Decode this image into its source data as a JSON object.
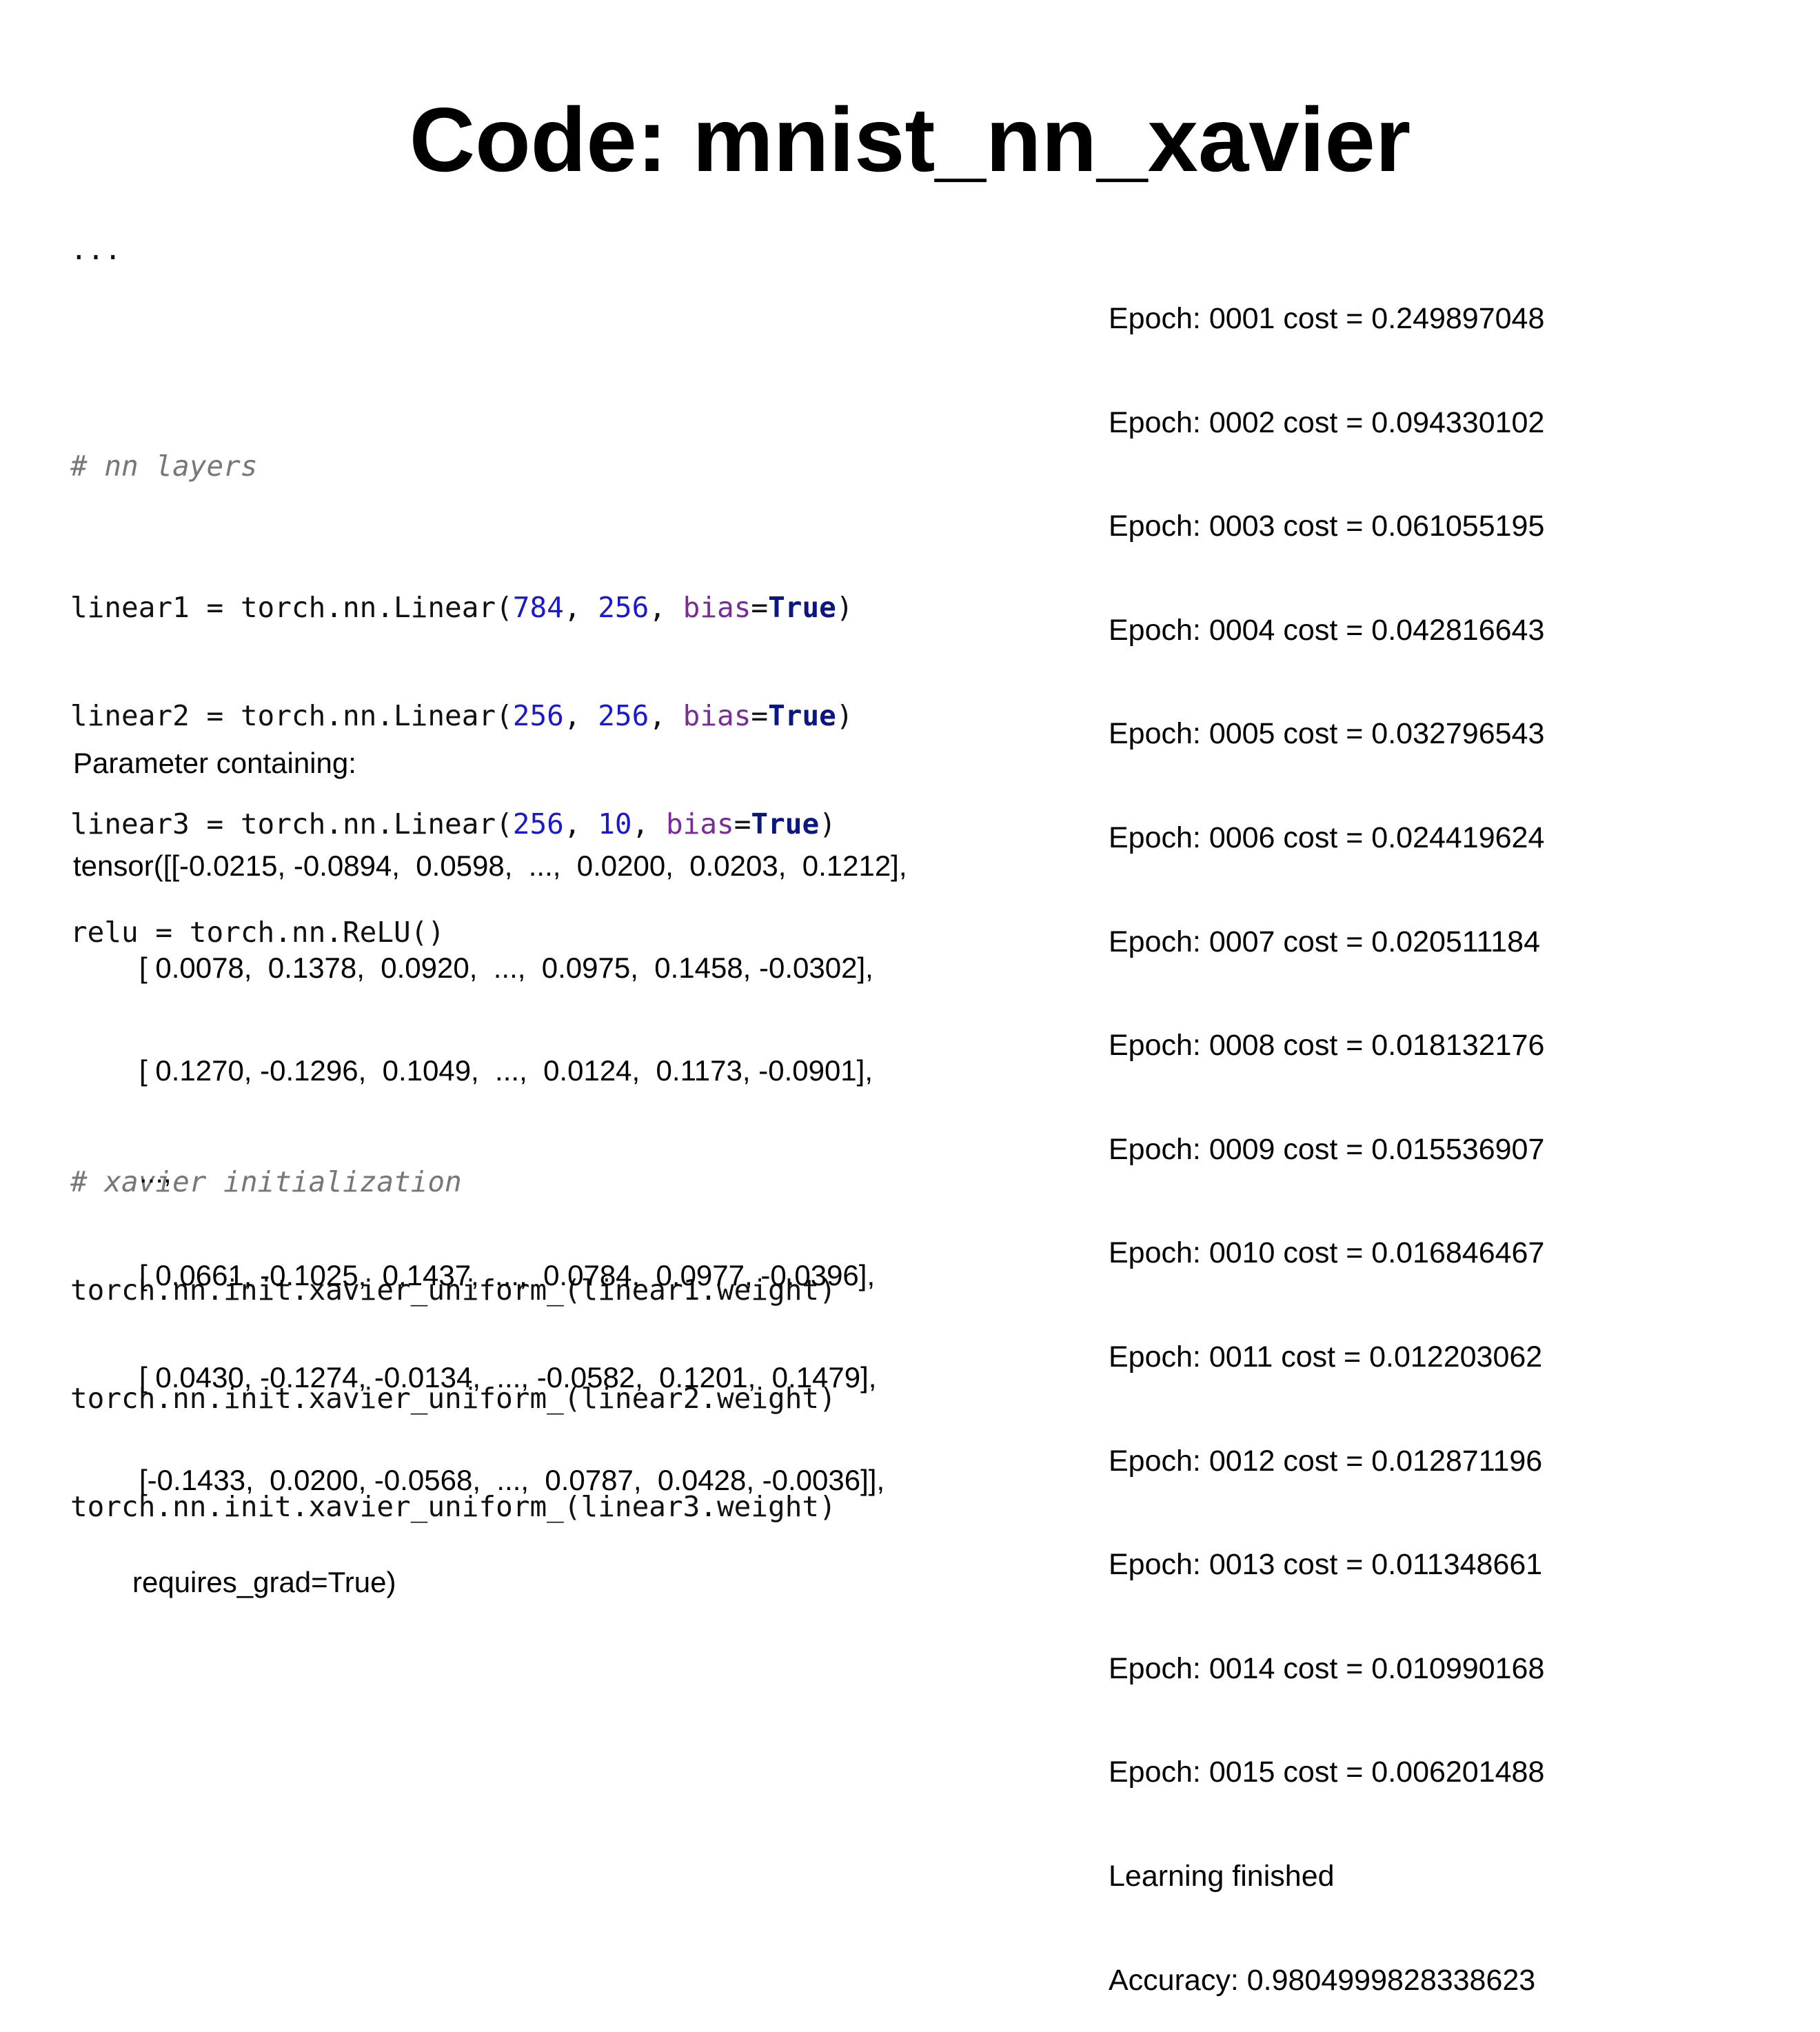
{
  "title": "Code: mnist_nn_xavier",
  "code": {
    "ellipsis": "...",
    "comment_layers": "# nn layers",
    "lines": [
      {
        "prefix": "linear1 = torch.nn.Linear(",
        "a": "784",
        "b": "256",
        "kw": "bias",
        "val": "True"
      },
      {
        "prefix": "linear2 = torch.nn.Linear(",
        "a": "256",
        "b": "256",
        "kw": "bias",
        "val": "True"
      },
      {
        "prefix": "linear3 = torch.nn.Linear(",
        "a": "256",
        "b": "10",
        "kw": "bias",
        "val": "True"
      }
    ],
    "relu_line": "relu = torch.nn.ReLU()",
    "comment_xavier": "# xavier initialization",
    "init_lines": [
      "torch.nn.init.xavier_uniform_(linear1.weight)",
      "torch.nn.init.xavier_uniform_(linear2.weight)",
      "torch.nn.init.xavier_uniform_(linear3.weight)"
    ]
  },
  "parameter_output": {
    "header": "Parameter containing:",
    "first_row": "tensor([[-0.0215, -0.0894,  0.0598,  ...,  0.0200,  0.0203,  0.1212],",
    "rows": [
      "[ 0.0078,  0.1378,  0.0920,  ...,  0.0975,  0.1458, -0.0302],",
      "[ 0.1270, -0.1296,  0.1049,  ...,  0.0124,  0.1173, -0.0901],",
      "...,",
      "[ 0.0661, -0.1025,  0.1437,  ...,  0.0784,  0.0977, -0.0396],",
      "[ 0.0430, -0.1274, -0.0134,  ..., -0.0582,  0.1201,  0.1479],",
      "[-0.1433,  0.0200, -0.0568,  ...,  0.0787,  0.0428, -0.0036]],"
    ],
    "footer": "requires_grad=True)"
  },
  "training_output": {
    "epochs": [
      "Epoch: 0001 cost = 0.249897048",
      "Epoch: 0002 cost = 0.094330102",
      "Epoch: 0003 cost = 0.061055195",
      "Epoch: 0004 cost = 0.042816643",
      "Epoch: 0005 cost = 0.032796543",
      "Epoch: 0006 cost = 0.024419624",
      "Epoch: 0007 cost = 0.020511184",
      "Epoch: 0008 cost = 0.018132176",
      "Epoch: 0009 cost = 0.015536907",
      "Epoch: 0010 cost = 0.016846467",
      "Epoch: 0011 cost = 0.012203062",
      "Epoch: 0012 cost = 0.012871196",
      "Epoch: 0013 cost = 0.011348661",
      "Epoch: 0014 cost = 0.010990168",
      "Epoch: 0015 cost = 0.006201488"
    ],
    "finished": "Learning finished",
    "accuracy": "Accuracy: 0.9804999828338623"
  }
}
